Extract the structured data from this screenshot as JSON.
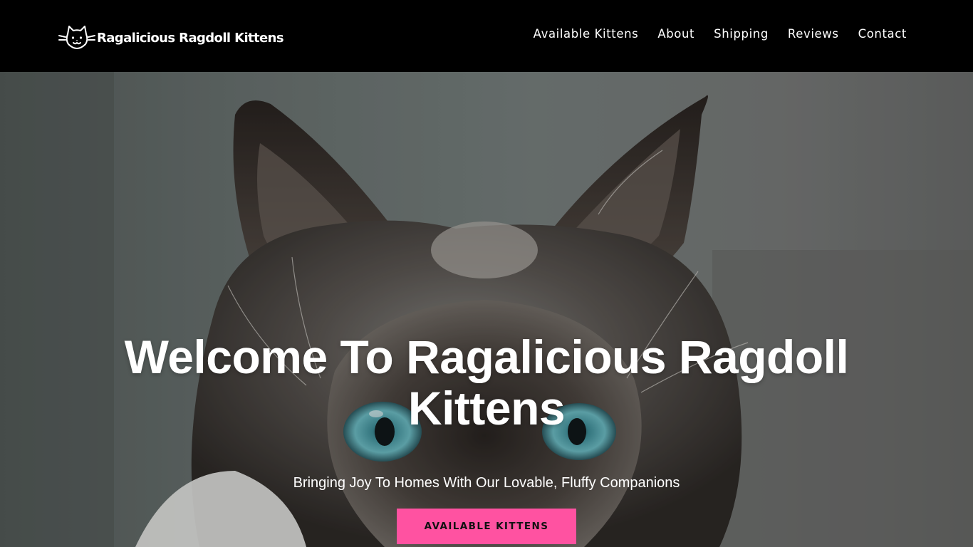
{
  "header": {
    "logo_text": "Ragalicious Ragdoll Kittens",
    "logo_icon": "cat-face-icon",
    "nav": [
      {
        "label": "Available Kittens"
      },
      {
        "label": "About"
      },
      {
        "label": "Shipping"
      },
      {
        "label": "Reviews"
      },
      {
        "label": "Contact"
      }
    ]
  },
  "hero": {
    "title": "Welcome To Ragalicious Ragdoll Kittens",
    "subtitle": "Bringing Joy To Homes With Our Lovable, Fluffy Companions",
    "button_label": "AVAILABLE KITTENS",
    "background_image": "siamese-cat-photo"
  },
  "colors": {
    "header_bg": "#000000",
    "accent": "#ff52a1",
    "text": "#ffffff"
  }
}
